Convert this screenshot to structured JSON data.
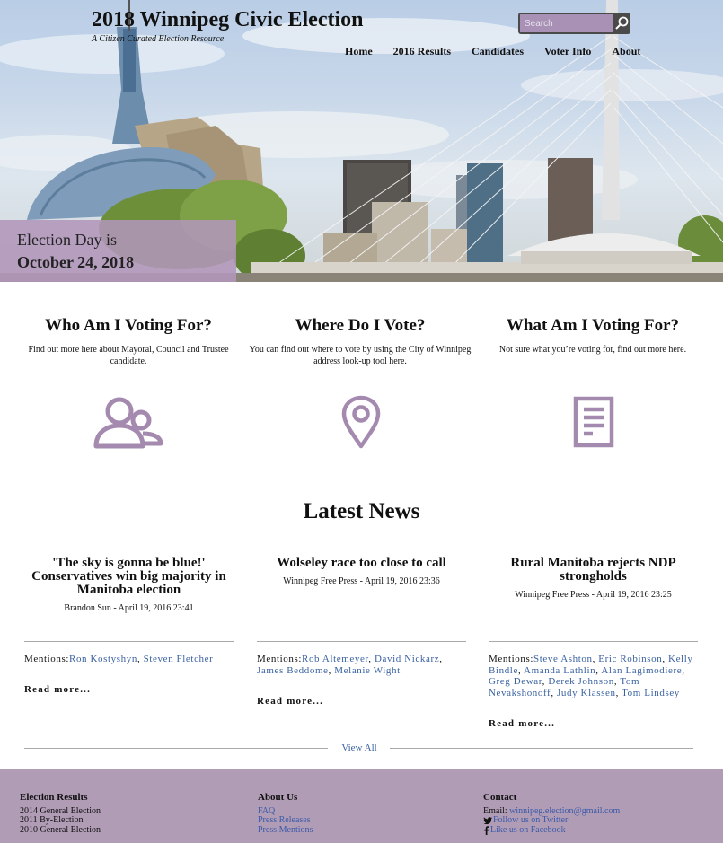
{
  "header": {
    "title": "2018 Winnipeg Civic Election",
    "tagline": "A Citizen Curated Election Resource",
    "search_placeholder": "Search",
    "nav": [
      "Home",
      "2016 Results",
      "Candidates",
      "Voter Info",
      "About"
    ]
  },
  "election_day": {
    "line1": "Election Day is",
    "line2": "October 24, 2018"
  },
  "features": [
    {
      "title": "Who Am I Voting For?",
      "text": "Find out more here about Mayoral, Council and Trustee candidate.",
      "icon": "people-icon"
    },
    {
      "title": "Where Do I Vote?",
      "text": "You can find out where to vote by using the City of Winnipeg address look-up tool here.",
      "icon": "map-pin-icon"
    },
    {
      "title": "What Am I Voting For?",
      "text": "Not sure what you’re voting for, find out more here.",
      "icon": "document-icon"
    }
  ],
  "news": {
    "title": "Latest News",
    "articles": [
      {
        "headline": "'The sky is gonna be blue!' Conservatives win big majority in Manitoba election",
        "source": "Brandon Sun - April 19, 2016 23:41",
        "mentions_label": "Mentions:",
        "mentions": [
          "Ron Kostyshyn",
          "Steven Fletcher"
        ],
        "read_more": "Read more..."
      },
      {
        "headline": "Wolseley race too close to call",
        "source": "Winnipeg Free Press - April 19, 2016 23:36",
        "mentions_label": "Mentions:",
        "mentions": [
          "Rob Altemeyer",
          "David Nickarz",
          "James Beddome",
          "Melanie Wight"
        ],
        "read_more": "Read more..."
      },
      {
        "headline": "Rural Manitoba rejects NDP strongholds",
        "source": "Winnipeg Free Press - April 19, 2016 23:25",
        "mentions_label": "Mentions:",
        "mentions": [
          "Steve Ashton",
          "Eric Robinson",
          "Kelly Bindle",
          "Amanda Lathlin",
          "Alan Lagimodiere",
          "Greg Dewar",
          "Derek Johnson",
          "Tom Nevakshonoff",
          "Judy Klassen",
          "Tom Lindsey"
        ],
        "read_more": "Read more..."
      }
    ],
    "view_all": "View All"
  },
  "footer": {
    "results": {
      "title": "Election Results",
      "items": [
        "2014 General Election",
        "2011 By-Election",
        "2010 General Election"
      ]
    },
    "about": {
      "title": "About Us",
      "links": [
        "FAQ",
        "Press Releases",
        "Press Mentions"
      ]
    },
    "contact": {
      "title": "Contact",
      "email_label": "Email: ",
      "email": "winnipeg.election@gmail.com",
      "twitter": "Follow us on Twitter",
      "facebook": "Like us on Facebook"
    }
  },
  "colors": {
    "accent": "#a58ab0",
    "footer_bg": "#b19cb6",
    "link": "#3a62a0",
    "banner": "#b296ba"
  }
}
